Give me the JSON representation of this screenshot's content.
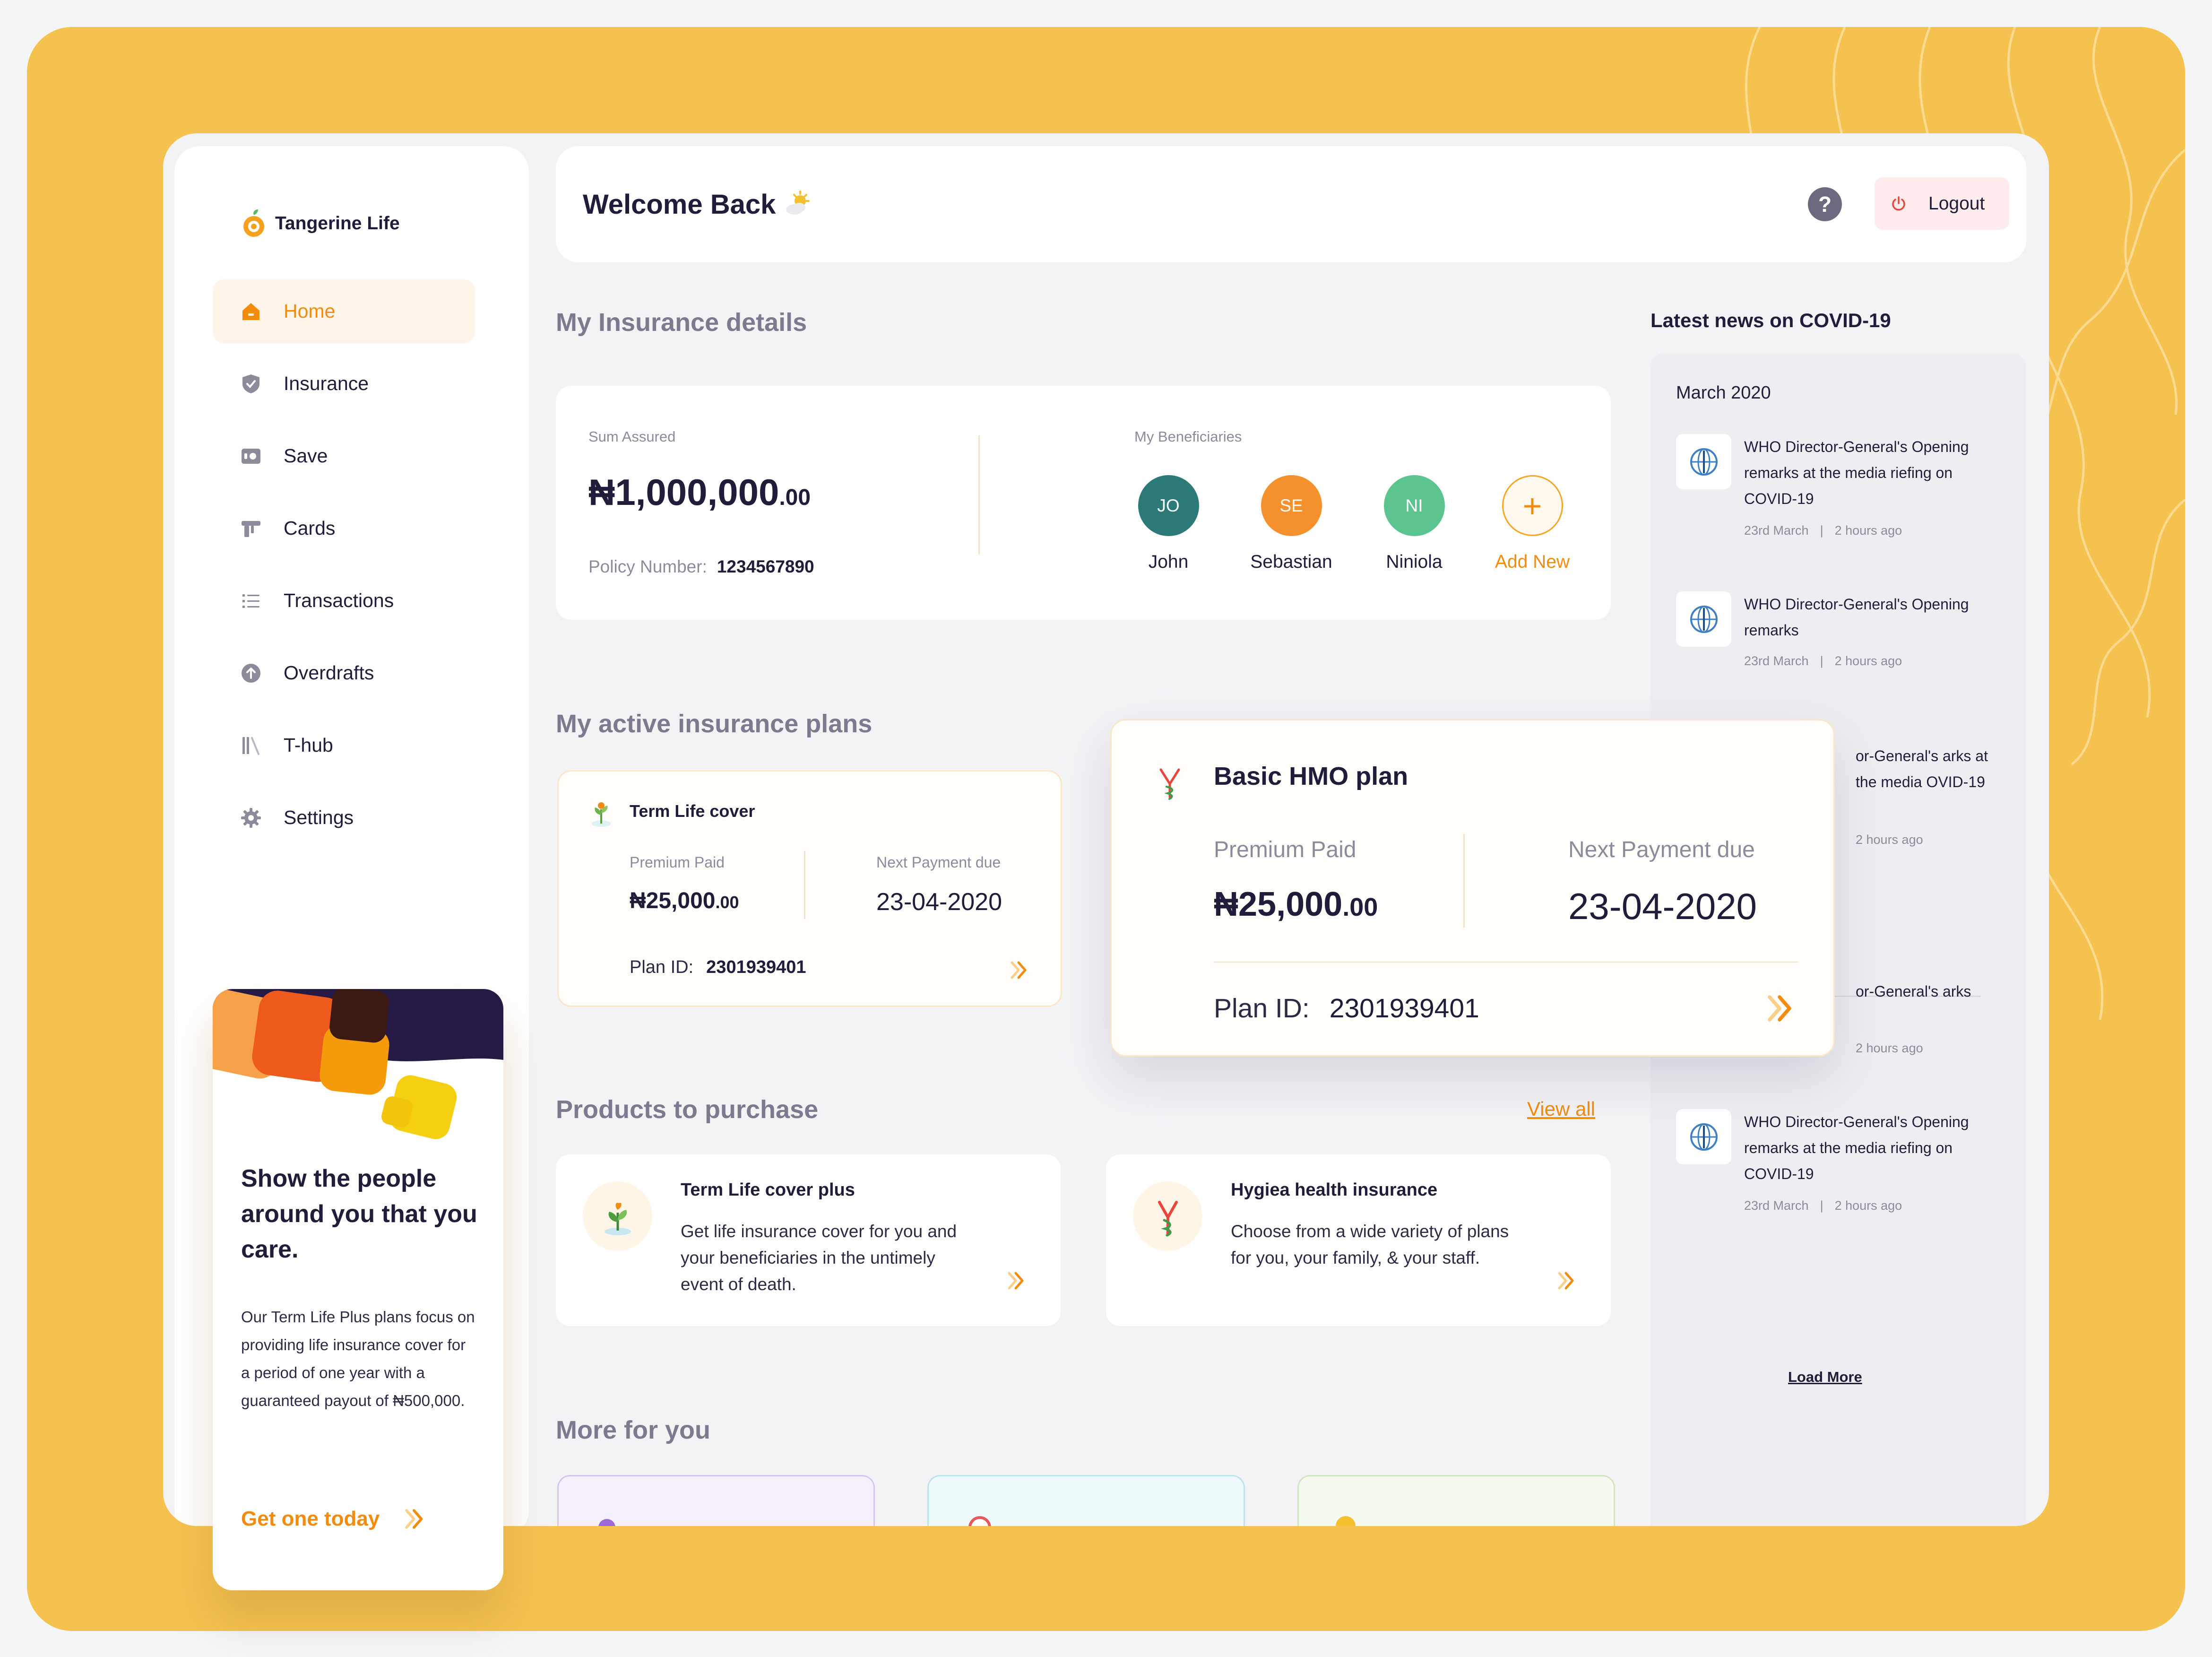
{
  "brand": {
    "name": "Tangerine Life"
  },
  "sidebar": {
    "items": [
      {
        "label": "Home",
        "icon": "home-icon",
        "active": true
      },
      {
        "label": "Insurance",
        "icon": "shield-icon"
      },
      {
        "label": "Save",
        "icon": "safe-icon"
      },
      {
        "label": "Cards",
        "icon": "cards-icon"
      },
      {
        "label": "Transactions",
        "icon": "list-icon"
      },
      {
        "label": "Overdrafts",
        "icon": "arrow-up-circle-icon"
      },
      {
        "label": "T-hub",
        "icon": "library-icon"
      },
      {
        "label": "Settings",
        "icon": "gear-icon"
      }
    ]
  },
  "promo": {
    "title": "Show the people around you that you care.",
    "body": "Our Term Life Plus plans focus on providing life insurance cover for a period of one year with a guaranteed payout of ₦500,000.",
    "cta": "Get one today"
  },
  "header": {
    "welcome": "Welcome Back",
    "help": "?",
    "logout": "Logout"
  },
  "insurance_details": {
    "title": "My Insurance details",
    "sum_assured_label": "Sum Assured",
    "sum_assured_main": "₦1,000,000",
    "sum_assured_cents": ".00",
    "policy_label": "Policy Number:",
    "policy_number": "1234567890",
    "beneficiaries_label": "My Beneficiaries",
    "beneficiaries": [
      {
        "initials": "JO",
        "name": "John",
        "color": "#2b7a78"
      },
      {
        "initials": "SE",
        "name": "Sebastian",
        "color": "#f4912c"
      },
      {
        "initials": "NI",
        "name": "Niniola",
        "color": "#5cc58f"
      }
    ],
    "add_new": "Add New"
  },
  "active_plans": {
    "title": "My active insurance plans",
    "plans": [
      {
        "name": "Term Life cover",
        "premium_label": "Premium Paid",
        "premium_main": "₦25,000",
        "premium_cents": ".00",
        "next_label": "Next Payment due",
        "next_date": "23-04-2020",
        "plan_id_label": "Plan ID:",
        "plan_id": "2301939401"
      },
      {
        "name": "Basic HMO plan",
        "premium_label": "Premium Paid",
        "premium_main": "₦25,000",
        "premium_cents": ".00",
        "next_label": "Next Payment due",
        "next_date": "23-04-2020",
        "plan_id_label": "Plan ID:",
        "plan_id": "2301939401"
      }
    ]
  },
  "products": {
    "title": "Products to purchase",
    "view_all": "View all",
    "items": [
      {
        "name": "Term Life cover plus",
        "desc": "Get life insurance cover for you and your beneficiaries in the untimely event of death."
      },
      {
        "name": "Hygiea health insurance",
        "desc": "Choose from a wide variety of plans for you, your family, & your staff."
      }
    ]
  },
  "more": {
    "title": "More for you"
  },
  "news": {
    "heading": "Latest news on COVID-19",
    "month": "March 2020",
    "items": [
      {
        "title": "WHO Director-General's Opening remarks at the media riefing on COVID-19",
        "date": "23rd March",
        "ago": "2 hours ago"
      },
      {
        "title": "WHO Director-General's Opening remarks",
        "date": "23rd March",
        "ago": "2 hours ago"
      },
      {
        "title": "or-General's arks at the media OVID-19",
        "date": "",
        "ago": "2 hours ago"
      },
      {
        "title": "or-General's arks",
        "date": "",
        "ago": "2 hours ago"
      },
      {
        "title": "WHO Director-General's Opening remarks at the media riefing on COVID-19",
        "date": "23rd March",
        "ago": "2 hours ago"
      }
    ],
    "load_more": "Load More"
  },
  "colors": {
    "accent": "#f28c0f",
    "backdrop": "#f5c250",
    "text": "#1f1d3a"
  }
}
